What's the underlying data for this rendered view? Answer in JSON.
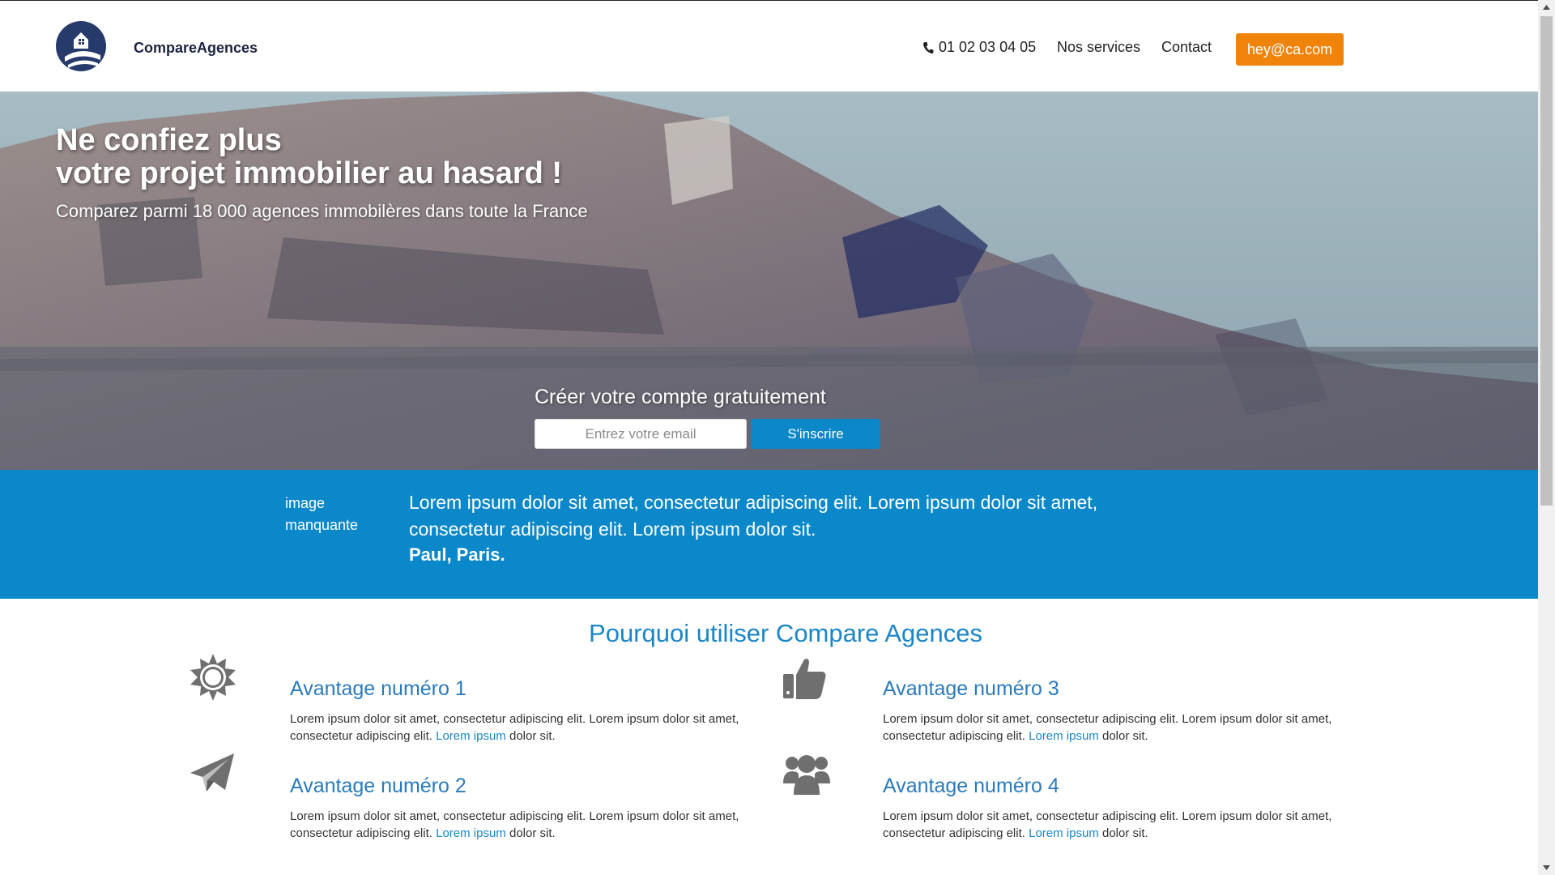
{
  "header": {
    "brand": "CompareAgences",
    "phone": "01 02 03 04 05",
    "nav_services": "Nos services",
    "nav_contact": "Contact",
    "cta_email": "hey@ca.com"
  },
  "hero": {
    "title_line1": "Ne confiez plus",
    "title_line2": "votre projet immobilier au hasard !",
    "subtitle": "Comparez parmi 18 000 agences immobilères dans toute la France",
    "signup_title": "Créer votre compte gratuitement",
    "email_placeholder": "Entrez votre email",
    "signup_button": "S'inscrire"
  },
  "testimonial": {
    "missing_image_line1": "image",
    "missing_image_line2": "manquante",
    "quote_line1": "Lorem ipsum dolor sit amet, consectetur adipiscing elit. Lorem ipsum dolor sit amet,",
    "quote_line2": "consectetur adipiscing elit. Lorem ipsum dolor sit.",
    "author": "Paul, Paris."
  },
  "advantages": {
    "section_title": "Pourquoi utiliser Compare Agences",
    "items": [
      {
        "title": "Avantage numéro 1",
        "text_line1": "Lorem ipsum dolor sit amet, consectetur adipiscing elit. Lorem ipsum dolor sit amet,",
        "text_before_link": "consectetur adipiscing elit. ",
        "link": "Lorem ipsum",
        "text_after_link": " dolor sit.",
        "icon": "sun-icon"
      },
      {
        "title": "Avantage numéro 2",
        "text_line1": "Lorem ipsum dolor sit amet, consectetur adipiscing elit. Lorem ipsum dolor sit amet,",
        "text_before_link": "consectetur adipiscing elit. ",
        "link": "Lorem ipsum",
        "text_after_link": " dolor sit.",
        "icon": "paper-plane-icon"
      },
      {
        "title": "Avantage numéro 3",
        "text_line1": "Lorem ipsum dolor sit amet, consectetur adipiscing elit. Lorem ipsum dolor sit amet,",
        "text_before_link": "consectetur adipiscing elit. ",
        "link": "Lorem ipsum",
        "text_after_link": " dolor sit.",
        "icon": "thumbs-up-icon"
      },
      {
        "title": "Avantage numéro 4",
        "text_line1": "Lorem ipsum dolor sit amet, consectetur adipiscing elit. Lorem ipsum dolor sit amet,",
        "text_before_link": "consectetur adipiscing elit. ",
        "link": "Lorem ipsum",
        "text_after_link": " dolor sit.",
        "icon": "users-icon"
      }
    ]
  },
  "colors": {
    "accent_blue": "#0b88c9",
    "cta_orange": "#f0830a",
    "title_blue": "#1a86c7",
    "icon_gray": "#777777"
  }
}
